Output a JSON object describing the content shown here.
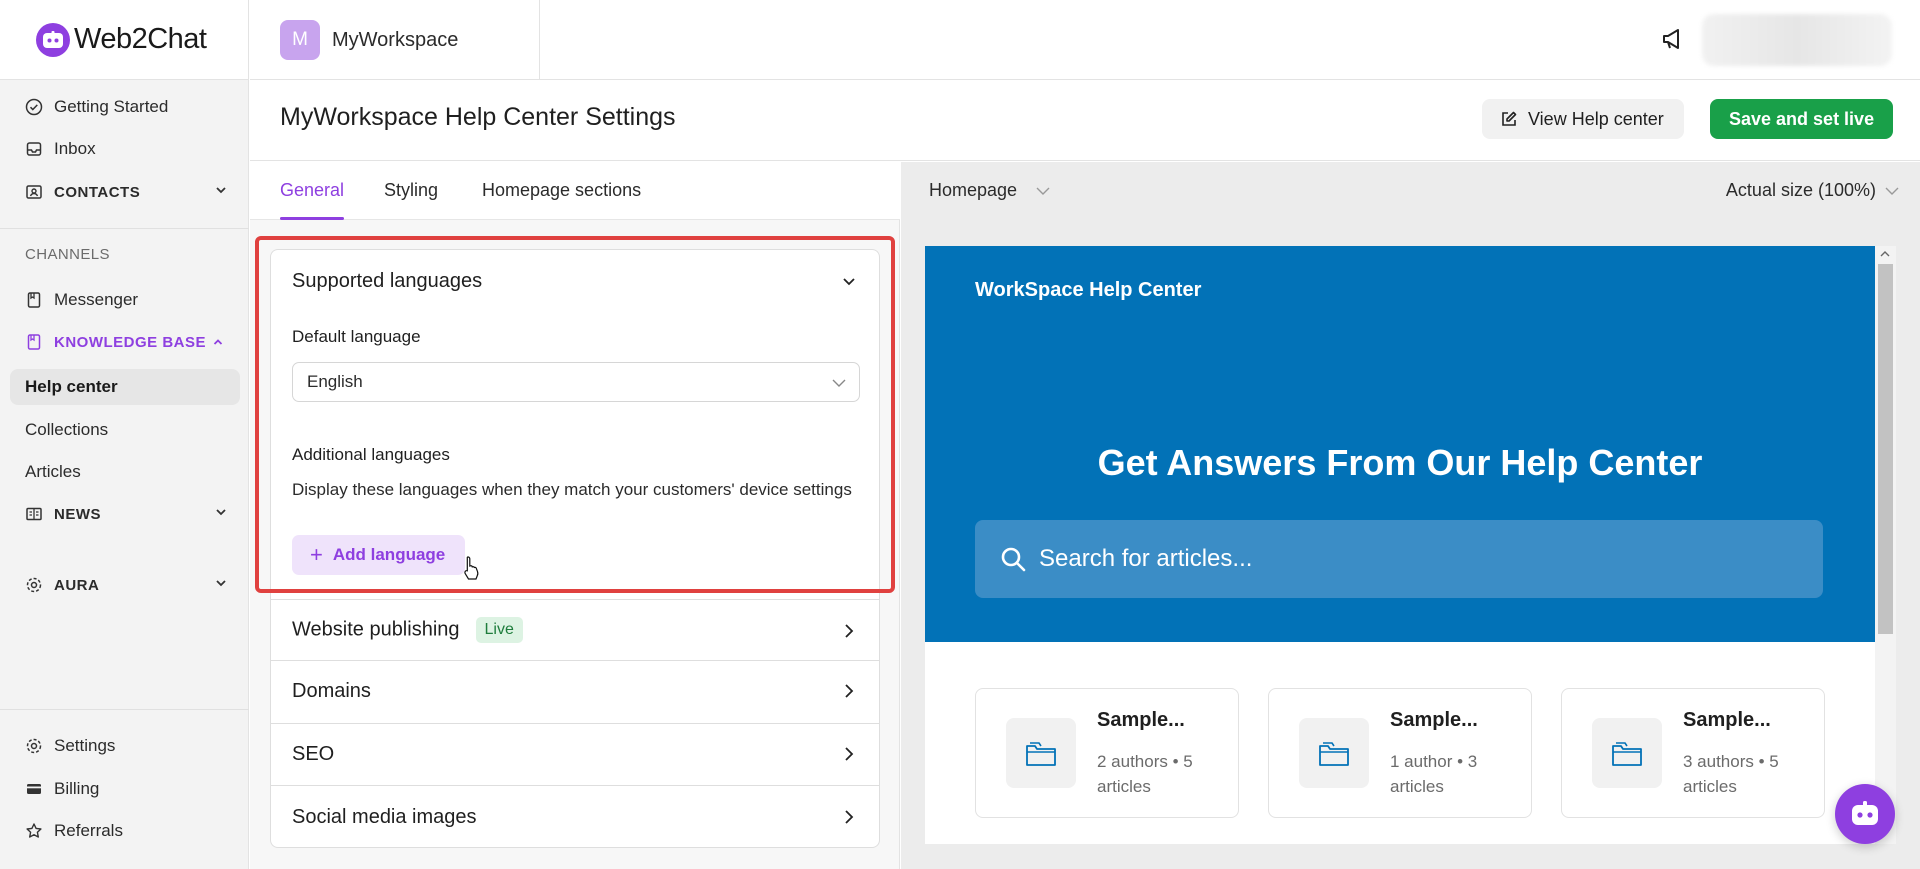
{
  "brand": {
    "name": "Web2Chat",
    "accent": "#8e3fe0"
  },
  "sidebar": {
    "getting_started": "Getting Started",
    "inbox": "Inbox",
    "contacts": "CONTACTS",
    "channels_label": "CHANNELS",
    "messenger": "Messenger",
    "knowledge_base": "KNOWLEDGE BASE",
    "help_center": "Help center",
    "collections": "Collections",
    "articles": "Articles",
    "news": "NEWS",
    "aura": "AURA",
    "settings": "Settings",
    "billing": "Billing",
    "referrals": "Referrals"
  },
  "workspace": {
    "initial": "M",
    "name": "MyWorkspace"
  },
  "header": {
    "title": "MyWorkspace Help Center Settings",
    "view_button": "View Help center",
    "save_button": "Save and set live"
  },
  "tabs": [
    "General",
    "Styling",
    "Homepage sections"
  ],
  "languages": {
    "title": "Supported languages",
    "default_label": "Default language",
    "default_value": "English",
    "additional_label": "Additional languages",
    "description": "Display these languages when they match your customers' device settings",
    "add_button": "Add language"
  },
  "sections": {
    "website_publishing": "Website publishing",
    "live_badge": "Live",
    "domains": "Domains",
    "seo": "SEO",
    "social": "Social media images"
  },
  "preview": {
    "page_select": "Homepage",
    "size_select": "Actual size (100%)",
    "site_brand": "WorkSpace Help Center",
    "heading": "Get Answers From Our Help Center",
    "search_placeholder": "Search for articles...",
    "collections": [
      {
        "title": "Sample...",
        "meta": "2 authors • 5 articles"
      },
      {
        "title": "Sample...",
        "meta": "1 author • 3 articles"
      },
      {
        "title": "Sample...",
        "meta": "3 authors • 5 articles"
      }
    ],
    "hero_color": "#0272b7"
  },
  "colors": {
    "save": "#19a049",
    "highlight": "#e0413f"
  }
}
